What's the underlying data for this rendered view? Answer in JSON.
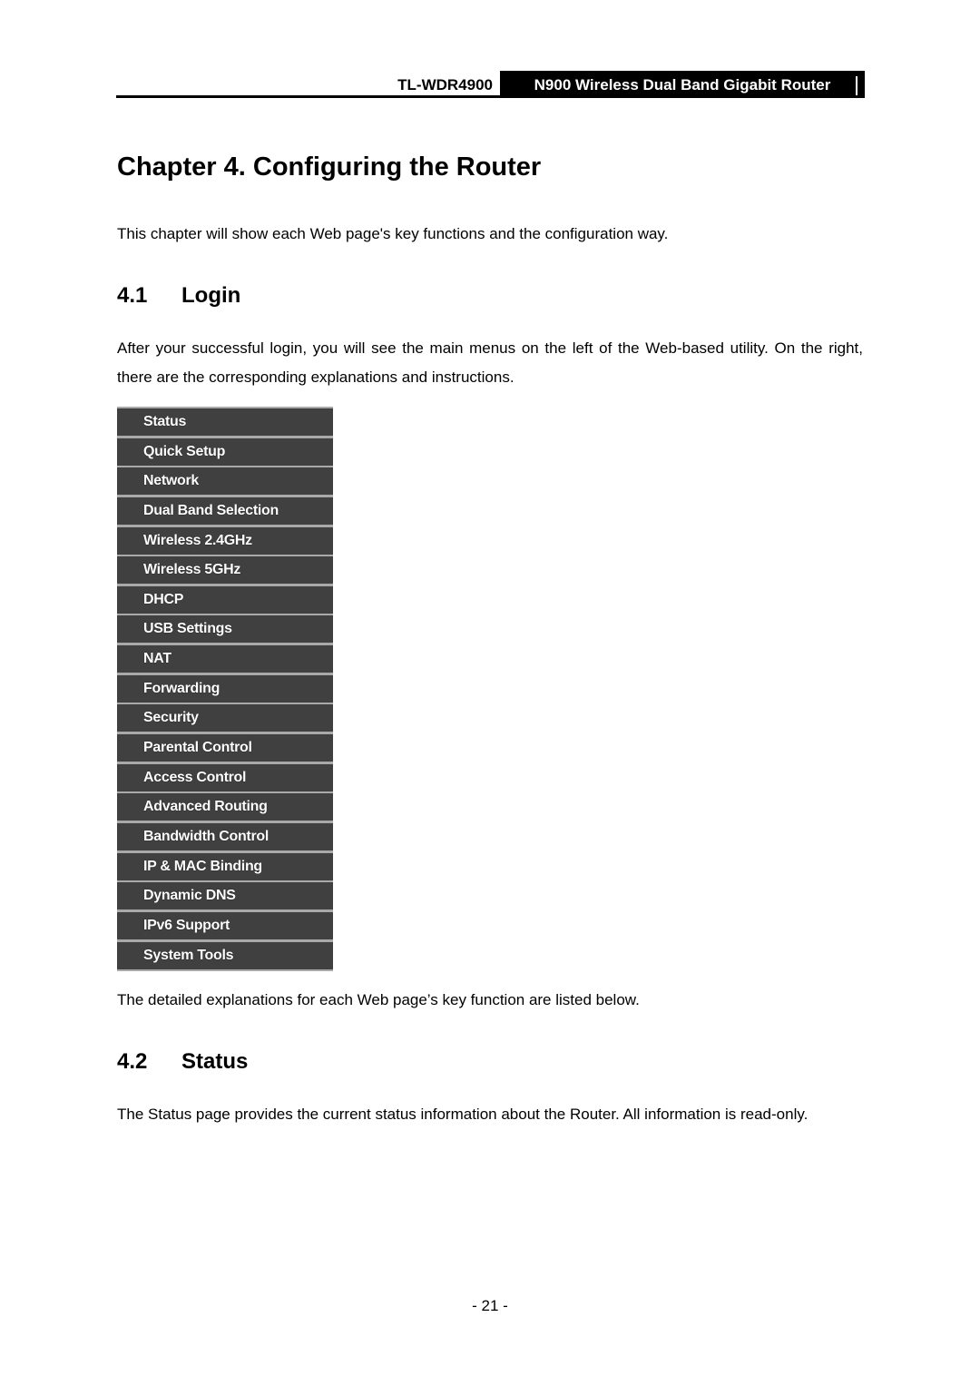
{
  "header": {
    "model": "TL-WDR4900",
    "product": "N900 Wireless Dual Band Gigabit Router"
  },
  "chapter": {
    "title": "Chapter 4.   Configuring the Router",
    "intro": "This chapter will show each Web page's key functions and the configuration way."
  },
  "sections": [
    {
      "number": "4.1",
      "title": "Login",
      "text": "After your successful login, you will see the main menus on the left of the Web-based utility. On the right, there are the corresponding explanations and instructions.",
      "after_text": "The detailed explanations for each Web page’s key function are listed below."
    },
    {
      "number": "4.2",
      "title": "Status",
      "text": "The Status page provides the current status information about the Router. All information is read-only."
    }
  ],
  "menu": {
    "items": [
      "Status",
      "Quick Setup",
      "Network",
      "Dual Band Selection",
      "Wireless 2.4GHz",
      "Wireless 5GHz",
      "DHCP",
      "USB Settings",
      "NAT",
      "Forwarding",
      "Security",
      "Parental Control",
      "Access Control",
      "Advanced Routing",
      "Bandwidth Control",
      "IP & MAC Binding",
      "Dynamic DNS",
      "IPv6 Support",
      "System Tools"
    ]
  },
  "footer": {
    "page_number": "- 21 -"
  }
}
